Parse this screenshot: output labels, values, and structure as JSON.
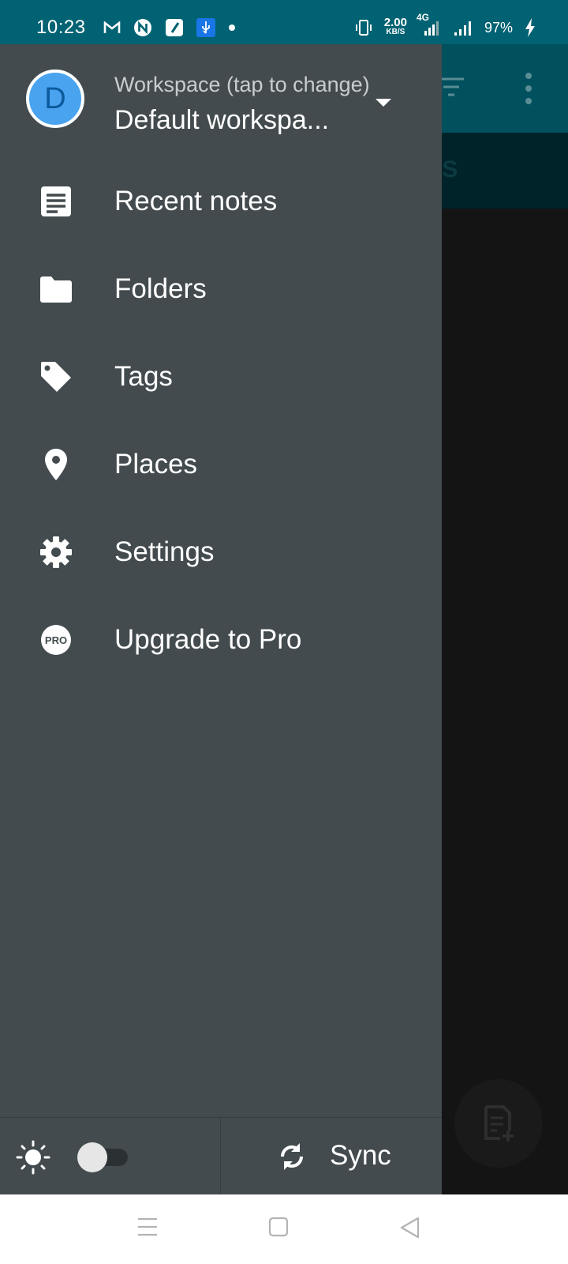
{
  "status_bar": {
    "time": "10:23",
    "net_speed_value": "2.00",
    "net_speed_unit": "KB/S",
    "network_type": "4G",
    "battery": "97%",
    "left_icons": [
      "gmail-icon",
      "n-app-icon",
      "note-app-icon",
      "usb-icon",
      "dot-icon"
    ],
    "right_icons": [
      "vibrate-icon",
      "signal-icon",
      "signal-icon-2",
      "charging-icon"
    ]
  },
  "background_app": {
    "tab_partial": "TES"
  },
  "drawer": {
    "avatar_letter": "D",
    "workspace_label": "Workspace (tap to change)",
    "workspace_name": "Default workspa...",
    "items": [
      {
        "label": "Recent notes",
        "icon": "recent-notes-icon"
      },
      {
        "label": "Folders",
        "icon": "folder-icon"
      },
      {
        "label": "Tags",
        "icon": "tag-icon"
      },
      {
        "label": "Places",
        "icon": "place-pin-icon"
      },
      {
        "label": "Settings",
        "icon": "gear-icon"
      },
      {
        "label": "Upgrade to Pro",
        "icon": "pro-badge-icon"
      }
    ],
    "pro_badge_text": "PRO",
    "footer": {
      "theme_toggle_on": false,
      "sync_label": "Sync"
    }
  },
  "colors": {
    "status_bar": "#006272",
    "drawer_bg": "#434b4e",
    "avatar_bg": "#4aa3ef",
    "nav_bar": "#ffffff"
  }
}
